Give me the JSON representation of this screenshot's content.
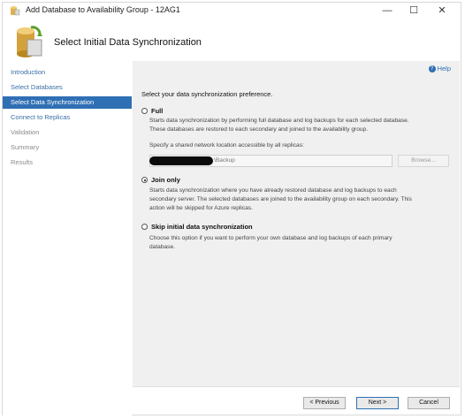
{
  "window": {
    "title": "Add Database to Availability Group - 12AG1",
    "minimize": "—",
    "maximize": "☐",
    "close": "✕"
  },
  "header": {
    "title": "Select Initial Data Synchronization"
  },
  "nav": {
    "items": [
      {
        "label": "Introduction",
        "state": "link"
      },
      {
        "label": "Select Databases",
        "state": "link"
      },
      {
        "label": "Select Data Synchronization",
        "state": "selected"
      },
      {
        "label": "Connect to Replicas",
        "state": "link"
      },
      {
        "label": "Validation",
        "state": "disabled"
      },
      {
        "label": "Summary",
        "state": "disabled"
      },
      {
        "label": "Results",
        "state": "disabled"
      }
    ]
  },
  "content": {
    "help_label": "Help",
    "section_title": "Select your data synchronization preference.",
    "options": {
      "full": {
        "label": "Full",
        "desc1": "Starts data synchronization by performing full database and log backups for each selected database.",
        "desc2": "These databases are restored to each secondary and joined to the availability group.",
        "selected": false
      },
      "join": {
        "label": "Join only",
        "desc1": "Starts data synchronization where you have already restored database and log backups to each",
        "desc2": "secondary server. The selected databases are joined to the availability group on each secondary. This",
        "desc3": "action will be skipped for Azure replicas.",
        "selected": true
      },
      "skip": {
        "label": "Skip initial data synchronization",
        "desc1": "Choose this option if you want to perform your own database and log backups of each primary",
        "desc2": "database.",
        "selected": false
      }
    },
    "network_location_label": "Specify a shared network location accessible by all replicas:",
    "network_location_value": "\\Backup",
    "browse_label": "Browse..."
  },
  "footer": {
    "previous": "< Previous",
    "next": "Next >",
    "cancel": "Cancel"
  },
  "colors": {
    "accent": "#2f6fb4",
    "link": "#3a6ea5",
    "content_bg": "#f0f0f0"
  }
}
